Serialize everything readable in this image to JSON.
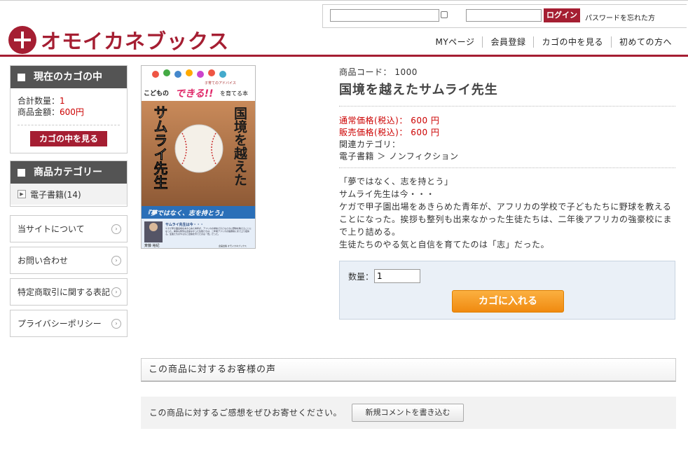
{
  "header": {
    "forgot_password": "パスワードを忘れた方",
    "login_label": "ログイン",
    "logo_text": "オモイカネブックス",
    "nav": [
      "MYページ",
      "会員登録",
      "カゴの中を見る",
      "初めての方へ"
    ]
  },
  "sidebar": {
    "cart_title": "現在のカゴの中",
    "total_qty_label": "合計数量：",
    "total_qty_value": "1",
    "total_amount_label": "商品金額：",
    "total_amount_value": "600円",
    "view_cart_button": "カゴの中を見る",
    "category_title": "商品カテゴリー",
    "categories": [
      "電子書籍(14)"
    ],
    "links": [
      "当サイトについて",
      "お問い合わせ",
      "特定商取引に関する表記",
      "プライバシーポリシー"
    ]
  },
  "cover": {
    "top_small": "子育てのアドバイス",
    "tagline_pre": "こどもの",
    "tagline_mid": "できる!!",
    "tagline_post": "を育てる本",
    "title_left": "サムライ先生",
    "title_right": "国境を越えた",
    "band": "『夢ではなく、志を持とう』",
    "sub_heading": "サムライ先生は今・・・",
    "sub_body": "ケガで甲子園出場をあきらめた青年が、アフリカの学校で子どもたちに野球を教えることになった。挨拶も整列も出来なかった生徒たちは、二年後アフリカの強豪校にまで上り詰める。生徒たちのやる気と自信を育てたのは「志」だった。",
    "author": "斉藤 裕紀",
    "publisher": "企画出版 オモイカネブックス"
  },
  "product": {
    "code_label": "商品コード：",
    "code_value": "1000",
    "title": "国境を越えたサムライ先生",
    "regular_price_label": "通常価格(税込)：",
    "regular_price_value": "600 円",
    "sale_price_label": "販売価格(税込)：",
    "sale_price_value": "600 円",
    "category_label": "関連カテゴリ：",
    "category_path": "電子書籍 ＞ ノンフィクション",
    "description": [
      "「夢ではなく、志を持とう」",
      "サムライ先生は今・・・",
      "ケガで甲子園出場をあきらめた青年が、アフリカの学校で子どもたちに野球を教えることになった。挨拶も整列も出来なかった生徒たちは、二年後アフリカの強豪校にまで上り詰める。",
      "生徒たちのやる気と自信を育てたのは「志」だった。"
    ],
    "quantity_label": "数量：",
    "quantity_value": "1",
    "add_to_cart": "カゴに入れる"
  },
  "reviews": {
    "heading": "この商品に対するお客様の声",
    "prompt": "この商品に対するご感想をぜひお寄せください。",
    "write_button": "新規コメントを書き込む"
  }
}
